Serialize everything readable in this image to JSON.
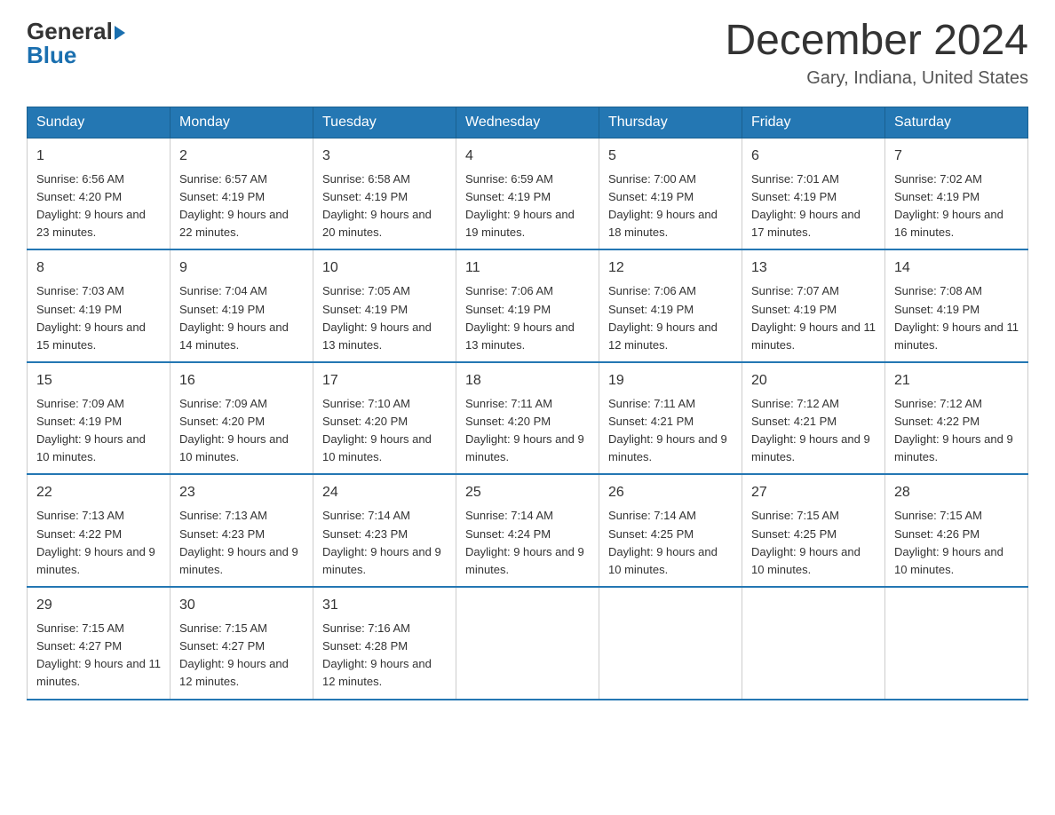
{
  "logo": {
    "part1": "General",
    "triangle": "▶",
    "part2": "Blue"
  },
  "title": "December 2024",
  "subtitle": "Gary, Indiana, United States",
  "days_header": [
    "Sunday",
    "Monday",
    "Tuesday",
    "Wednesday",
    "Thursday",
    "Friday",
    "Saturday"
  ],
  "weeks": [
    [
      {
        "day": "1",
        "sunrise": "6:56 AM",
        "sunset": "4:20 PM",
        "daylight": "9 hours and 23 minutes."
      },
      {
        "day": "2",
        "sunrise": "6:57 AM",
        "sunset": "4:19 PM",
        "daylight": "9 hours and 22 minutes."
      },
      {
        "day": "3",
        "sunrise": "6:58 AM",
        "sunset": "4:19 PM",
        "daylight": "9 hours and 20 minutes."
      },
      {
        "day": "4",
        "sunrise": "6:59 AM",
        "sunset": "4:19 PM",
        "daylight": "9 hours and 19 minutes."
      },
      {
        "day": "5",
        "sunrise": "7:00 AM",
        "sunset": "4:19 PM",
        "daylight": "9 hours and 18 minutes."
      },
      {
        "day": "6",
        "sunrise": "7:01 AM",
        "sunset": "4:19 PM",
        "daylight": "9 hours and 17 minutes."
      },
      {
        "day": "7",
        "sunrise": "7:02 AM",
        "sunset": "4:19 PM",
        "daylight": "9 hours and 16 minutes."
      }
    ],
    [
      {
        "day": "8",
        "sunrise": "7:03 AM",
        "sunset": "4:19 PM",
        "daylight": "9 hours and 15 minutes."
      },
      {
        "day": "9",
        "sunrise": "7:04 AM",
        "sunset": "4:19 PM",
        "daylight": "9 hours and 14 minutes."
      },
      {
        "day": "10",
        "sunrise": "7:05 AM",
        "sunset": "4:19 PM",
        "daylight": "9 hours and 13 minutes."
      },
      {
        "day": "11",
        "sunrise": "7:06 AM",
        "sunset": "4:19 PM",
        "daylight": "9 hours and 13 minutes."
      },
      {
        "day": "12",
        "sunrise": "7:06 AM",
        "sunset": "4:19 PM",
        "daylight": "9 hours and 12 minutes."
      },
      {
        "day": "13",
        "sunrise": "7:07 AM",
        "sunset": "4:19 PM",
        "daylight": "9 hours and 11 minutes."
      },
      {
        "day": "14",
        "sunrise": "7:08 AM",
        "sunset": "4:19 PM",
        "daylight": "9 hours and 11 minutes."
      }
    ],
    [
      {
        "day": "15",
        "sunrise": "7:09 AM",
        "sunset": "4:19 PM",
        "daylight": "9 hours and 10 minutes."
      },
      {
        "day": "16",
        "sunrise": "7:09 AM",
        "sunset": "4:20 PM",
        "daylight": "9 hours and 10 minutes."
      },
      {
        "day": "17",
        "sunrise": "7:10 AM",
        "sunset": "4:20 PM",
        "daylight": "9 hours and 10 minutes."
      },
      {
        "day": "18",
        "sunrise": "7:11 AM",
        "sunset": "4:20 PM",
        "daylight": "9 hours and 9 minutes."
      },
      {
        "day": "19",
        "sunrise": "7:11 AM",
        "sunset": "4:21 PM",
        "daylight": "9 hours and 9 minutes."
      },
      {
        "day": "20",
        "sunrise": "7:12 AM",
        "sunset": "4:21 PM",
        "daylight": "9 hours and 9 minutes."
      },
      {
        "day": "21",
        "sunrise": "7:12 AM",
        "sunset": "4:22 PM",
        "daylight": "9 hours and 9 minutes."
      }
    ],
    [
      {
        "day": "22",
        "sunrise": "7:13 AM",
        "sunset": "4:22 PM",
        "daylight": "9 hours and 9 minutes."
      },
      {
        "day": "23",
        "sunrise": "7:13 AM",
        "sunset": "4:23 PM",
        "daylight": "9 hours and 9 minutes."
      },
      {
        "day": "24",
        "sunrise": "7:14 AM",
        "sunset": "4:23 PM",
        "daylight": "9 hours and 9 minutes."
      },
      {
        "day": "25",
        "sunrise": "7:14 AM",
        "sunset": "4:24 PM",
        "daylight": "9 hours and 9 minutes."
      },
      {
        "day": "26",
        "sunrise": "7:14 AM",
        "sunset": "4:25 PM",
        "daylight": "9 hours and 10 minutes."
      },
      {
        "day": "27",
        "sunrise": "7:15 AM",
        "sunset": "4:25 PM",
        "daylight": "9 hours and 10 minutes."
      },
      {
        "day": "28",
        "sunrise": "7:15 AM",
        "sunset": "4:26 PM",
        "daylight": "9 hours and 10 minutes."
      }
    ],
    [
      {
        "day": "29",
        "sunrise": "7:15 AM",
        "sunset": "4:27 PM",
        "daylight": "9 hours and 11 minutes."
      },
      {
        "day": "30",
        "sunrise": "7:15 AM",
        "sunset": "4:27 PM",
        "daylight": "9 hours and 12 minutes."
      },
      {
        "day": "31",
        "sunrise": "7:16 AM",
        "sunset": "4:28 PM",
        "daylight": "9 hours and 12 minutes."
      },
      null,
      null,
      null,
      null
    ]
  ]
}
